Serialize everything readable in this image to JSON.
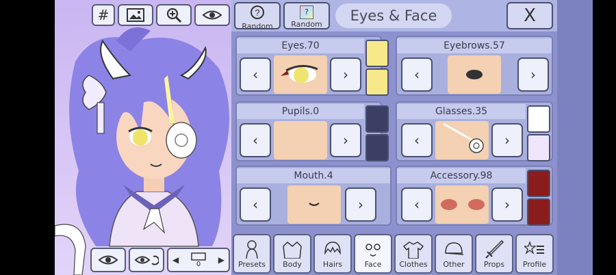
{
  "preview": {
    "buttons": [
      {
        "name": "grid-button",
        "glyph": "#"
      },
      {
        "name": "image-button",
        "glyph": ""
      },
      {
        "name": "zoom-button",
        "glyph": ""
      },
      {
        "name": "eye-button",
        "glyph": ""
      }
    ],
    "bottom": {
      "eye_label": "",
      "page_count": "0"
    }
  },
  "header": {
    "random1": "Random",
    "random2": "Random",
    "title": "Eyes & Face",
    "close": "X"
  },
  "cards": [
    {
      "label": "Eyes.70",
      "colors": [
        "#f7e98a",
        "#f7e98a"
      ]
    },
    {
      "label": "Eyebrows.57",
      "colors": []
    },
    {
      "label": "Pupils.0",
      "colors": [
        "#3b3f63",
        "#3b3f63"
      ]
    },
    {
      "label": "Glasses.35",
      "colors": [
        "#ffffff",
        "#efe6fb"
      ]
    },
    {
      "label": "Mouth.4",
      "colors": []
    },
    {
      "label": "Accessory.98",
      "colors": [
        "#8a1c1c",
        "#8a1c1c"
      ]
    }
  ],
  "tabs": [
    {
      "label": "Presets"
    },
    {
      "label": "Body"
    },
    {
      "label": "Hairs"
    },
    {
      "label": "Face"
    },
    {
      "label": "Clothes"
    },
    {
      "label": "Other"
    },
    {
      "label": "Props"
    },
    {
      "label": "Profile"
    }
  ],
  "colors": {
    "panel": "#8d92cf",
    "accent": "#4a4f73"
  }
}
